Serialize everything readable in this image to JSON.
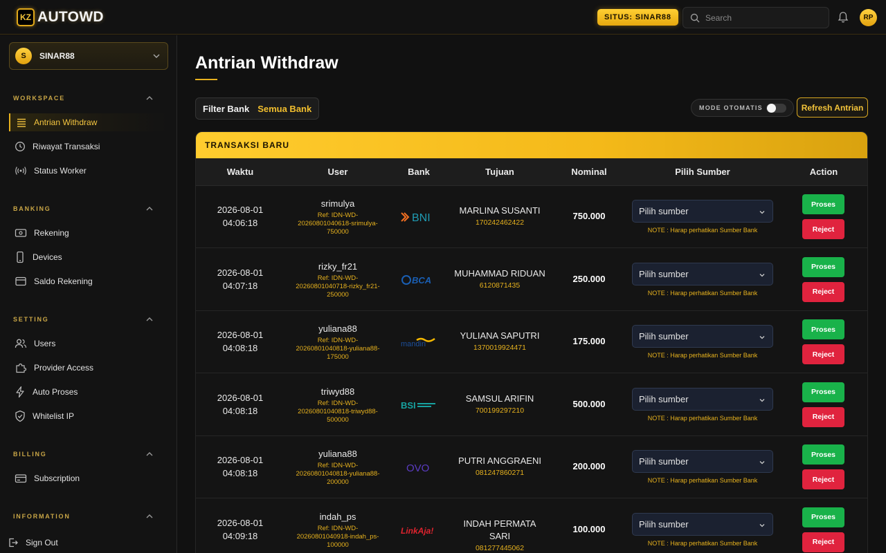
{
  "header": {
    "logo_badge": "KZ",
    "logo_text": "AUTOWD",
    "site_badge": "SITUS: SINAR88",
    "search_placeholder": "Search",
    "avatar": "RP"
  },
  "sidebar": {
    "site_avatar": "S",
    "site_name": "SINAR88",
    "sections": {
      "workspace": "WORKSPACE",
      "banking": "BANKING",
      "setting": "SETTING",
      "billing": "BILLING",
      "information": "INFORMATION"
    },
    "items": {
      "antrian_withdraw": "Antrian Withdraw",
      "riwayat_transaksi": "Riwayat Transaksi",
      "status_worker": "Status Worker",
      "rekening": "Rekening",
      "devices": "Devices",
      "saldo_rekening": "Saldo Rekening",
      "users": "Users",
      "provider_access": "Provider Access",
      "auto_proses": "Auto Proses",
      "whitelist_ip": "Whitelist IP",
      "subscription": "Subscription",
      "sign_out": "Sign Out"
    },
    "active_item": "antrian_withdraw"
  },
  "main": {
    "title": "Antrian Withdraw",
    "filter_label": "Filter Bank",
    "filter_value": "Semua Bank",
    "mode_label": "MODE OTOMATIS",
    "mode_enabled": false,
    "refresh_label": "Refresh Antrian",
    "card_title": "TRANSAKSI BARU",
    "columns": {
      "waktu": "Waktu",
      "user": "User",
      "bank": "Bank",
      "tujuan": "Tujuan",
      "nominal": "Nominal",
      "sumber": "Pilih Sumber",
      "action": "Action"
    },
    "select_placeholder": "Pilih sumber",
    "note": "NOTE : Harap perhatikan Sumber Bank",
    "proses_label": "Proses",
    "reject_label": "Reject",
    "rows": [
      {
        "date": "2026-08-01",
        "time": "04:06:18",
        "user": "srimulya",
        "ref1": "Ref: IDN-WD-",
        "ref2": "20260801040618-srimulya-",
        "ref3": "750000",
        "bank": "BNI",
        "bank_icon": "bni-logo",
        "tujuan1": "MARLINA SUSANTI",
        "tujuan2": "",
        "account": "170242462422",
        "nominal": "750.000"
      },
      {
        "date": "2026-08-01",
        "time": "04:07:18",
        "user": "rizky_fr21",
        "ref1": "Ref: IDN-WD-",
        "ref2": "20260801040718-rizky_fr21-",
        "ref3": "250000",
        "bank": "BCA",
        "bank_icon": "bca-logo",
        "tujuan1": "MUHAMMAD RIDUAN",
        "tujuan2": "",
        "account": "6120871435",
        "nominal": "250.000"
      },
      {
        "date": "2026-08-01",
        "time": "04:08:18",
        "user": "yuliana88",
        "ref1": "Ref: IDN-WD-",
        "ref2": "20260801040818-yuliana88-",
        "ref3": "175000",
        "bank": "mandiri",
        "bank_icon": "mandiri-logo",
        "tujuan1": "YULIANA SAPUTRI",
        "tujuan2": "",
        "account": "1370019924471",
        "nominal": "175.000"
      },
      {
        "date": "2026-08-01",
        "time": "04:08:18",
        "user": "triwyd88",
        "ref1": "Ref: IDN-WD-",
        "ref2": "20260801040818-triwyd88-",
        "ref3": "500000",
        "bank": "BSI",
        "bank_icon": "bsi-logo",
        "tujuan1": "SAMSUL ARIFIN",
        "tujuan2": "",
        "account": "700199297210",
        "nominal": "500.000"
      },
      {
        "date": "2026-08-01",
        "time": "04:08:18",
        "user": "yuliana88",
        "ref1": "Ref: IDN-WD-",
        "ref2": "20260801040818-yuliana88-",
        "ref3": "200000",
        "bank": "OVO",
        "bank_icon": "ovo-logo",
        "tujuan1": "PUTRI ANGGRAENI",
        "tujuan2": "",
        "account": "081247860271",
        "nominal": "200.000"
      },
      {
        "date": "2026-08-01",
        "time": "04:09:18",
        "user": "indah_ps",
        "ref1": "Ref: IDN-WD-",
        "ref2": "20260801040918-indah_ps-",
        "ref3": "100000",
        "bank": "LinkAja!",
        "bank_icon": "linkaja-logo",
        "tujuan1": "INDAH PERMATA",
        "tujuan2": "SARI",
        "account": "081277445062",
        "nominal": "100.000"
      }
    ]
  },
  "colors": {
    "accent": "#f2bf2e",
    "proses": "#19b24a",
    "reject": "#e0233e"
  }
}
